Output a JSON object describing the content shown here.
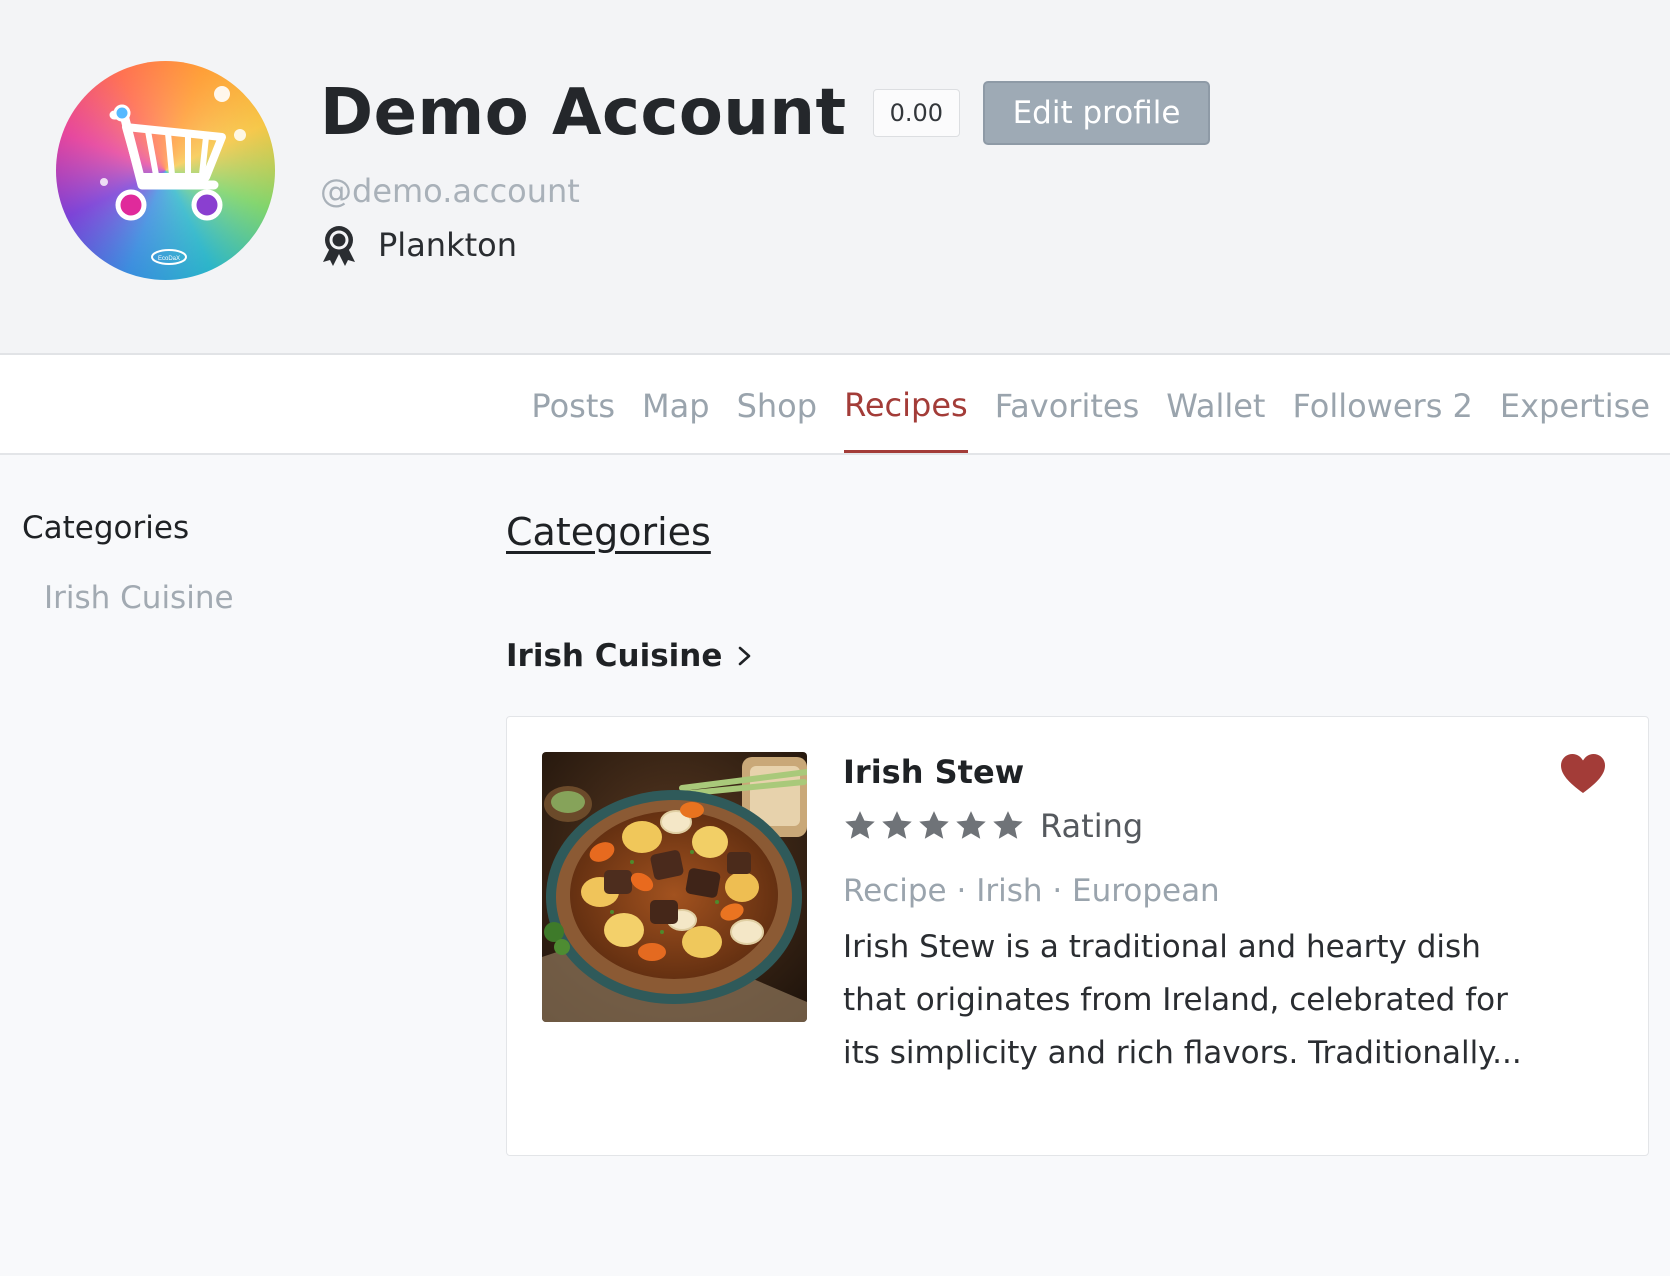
{
  "profile": {
    "name": "Demo Account",
    "score": "0.00",
    "edit_label": "Edit profile",
    "handle": "@demo.account",
    "rank": "Plankton",
    "avatar_text": "EcoDaX"
  },
  "tabs": [
    {
      "label": "Posts",
      "active": false
    },
    {
      "label": "Map",
      "active": false
    },
    {
      "label": "Shop",
      "active": false
    },
    {
      "label": "Recipes",
      "active": true
    },
    {
      "label": "Favorites",
      "active": false
    },
    {
      "label": "Wallet",
      "active": false
    },
    {
      "label": "Followers 2",
      "active": false
    },
    {
      "label": "Expertise",
      "active": false
    }
  ],
  "sidebar": {
    "title": "Categories",
    "items": [
      {
        "label": "Irish Cuisine"
      }
    ]
  },
  "main": {
    "title": "Categories",
    "section": {
      "label": "Irish Cuisine"
    }
  },
  "recipe": {
    "title": "Irish Stew",
    "rating_value": 5,
    "rating_max": 5,
    "rating_label": "Rating",
    "tags": "Recipe · Irish · European",
    "description": "Irish Stew is a traditional and hearty dish that originates from Ireland, celebrated for its simplicity and rich flavors. Traditionally...",
    "favorited": true
  },
  "colors": {
    "accent": "#a33c38",
    "muted": "#9aa4ad",
    "button": "#9eaab5",
    "heart": "#a33c38",
    "star": "#6f7378"
  },
  "icons": {
    "rank": "award-ribbon-icon",
    "section": "chevron-right-icon",
    "favorite": "heart-icon",
    "rating": "star-icon"
  }
}
